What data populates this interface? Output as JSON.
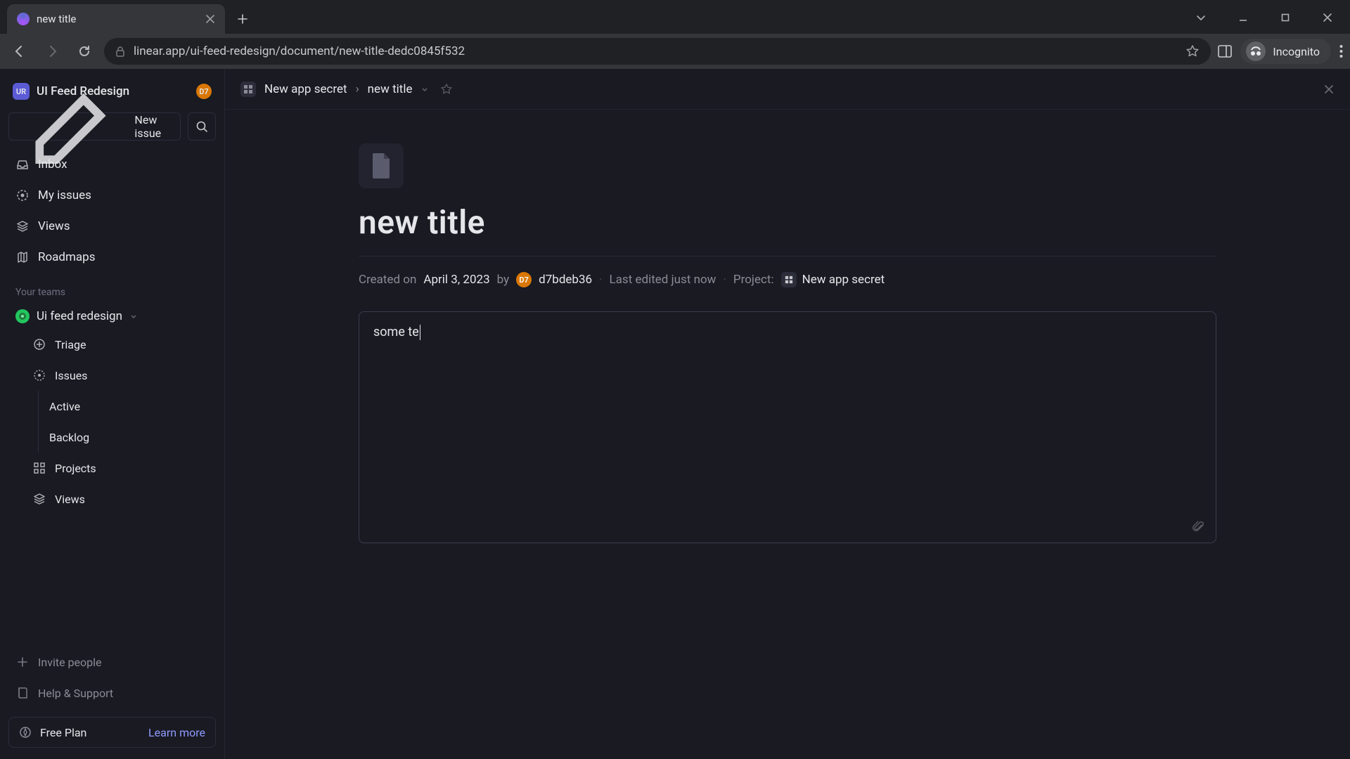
{
  "browser": {
    "tab_title": "new title",
    "url": "linear.app/ui-feed-redesign/document/new-title-dedc0845f532",
    "incognito_label": "Incognito"
  },
  "workspace": {
    "badge": "UR",
    "name": "UI Feed Redesign",
    "user_badge": "D7"
  },
  "sidebar": {
    "new_issue": "New issue",
    "nav": {
      "inbox": "Inbox",
      "my_issues": "My issues",
      "views": "Views",
      "roadmaps": "Roadmaps"
    },
    "teams_label": "Your teams",
    "team_name": "Ui feed redesign",
    "team_items": {
      "triage": "Triage",
      "issues": "Issues",
      "active": "Active",
      "backlog": "Backlog",
      "projects": "Projects",
      "views": "Views"
    },
    "invite": "Invite people",
    "help": "Help & Support",
    "plan": "Free Plan",
    "learn_more": "Learn more"
  },
  "breadcrumb": {
    "project": "New app secret",
    "sep": "›",
    "doc": "new title"
  },
  "document": {
    "title": "new title",
    "created_prefix": "Created on",
    "created_date": "April 3, 2023",
    "by": "by",
    "author": "d7bdeb36",
    "author_badge": "D7",
    "last_edited": "Last edited just now",
    "project_label": "Project:",
    "project_name": "New app secret",
    "body": "some te"
  }
}
